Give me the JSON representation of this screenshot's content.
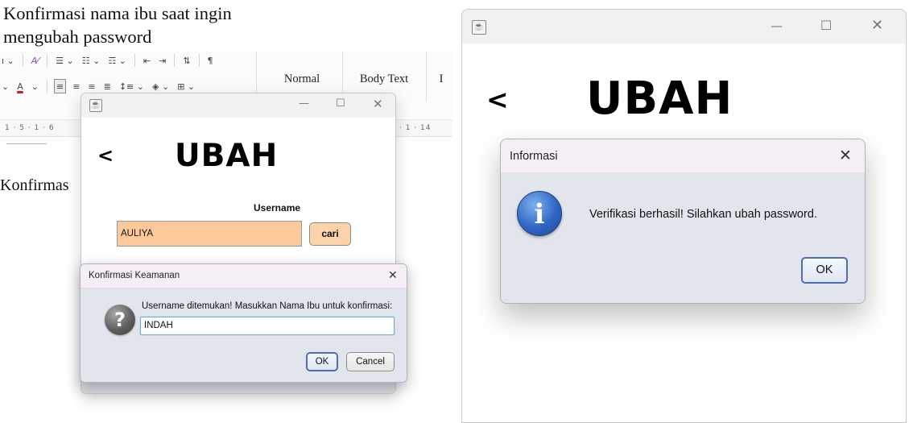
{
  "document": {
    "caption": "Konfirmasi nama ibu saat ingin mengubah password",
    "body_text": "Konfirmas",
    "ribbon_styles": [
      "Normal",
      "Body Text",
      "I"
    ],
    "ruler_left": "1 · 5 · 1 · 6",
    "ruler_right": "· 1 · 14"
  },
  "small_window": {
    "back_label": "<",
    "title": "UBAH",
    "username_label": "Username",
    "username_value": "AULIYA",
    "search_button": "cari"
  },
  "small_dialog": {
    "title": "Konfirmasi Keamanan",
    "message": "Username ditemukan! Masukkan Nama Ibu untuk konfirmasi:",
    "input_value": "INDAH",
    "ok_label": "OK",
    "cancel_label": "Cancel",
    "icon": "question-icon"
  },
  "large_window": {
    "back_label": "<",
    "title": "UBAH"
  },
  "large_dialog": {
    "title": "Informasi",
    "message": "Verifikasi berhasil! Silahkan ubah password.",
    "ok_label": "OK",
    "icon": "info-icon"
  },
  "colors": {
    "input_fill": "#fdc89a",
    "button_fill": "#fdd3ab",
    "dialog_bg": "#e2e6ec",
    "dialog_titlebar": "#f6eef5",
    "default_button_border": "#4d6fb1"
  }
}
